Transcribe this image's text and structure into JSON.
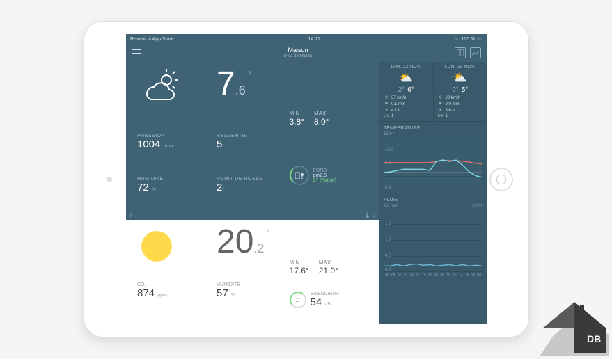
{
  "statusbar": {
    "left": "Revenir à App Store",
    "time": "14:17",
    "bt": "bluetooth",
    "battery": "100 %"
  },
  "header": {
    "title": "Maison",
    "subtitle": "il y a 3 minutes"
  },
  "outdoor": {
    "icon": "cloud-sun-icon",
    "temp_whole": "7",
    "temp_dec": ".6",
    "min_label": "MIN",
    "min": "3.8°",
    "max_label": "MAX",
    "max": "8.0°",
    "pressure_label": "PRESSION",
    "pressure": "1004",
    "pressure_unit": "mbar",
    "feels_label": "RESSENTIE",
    "feels": "5",
    "feels_deg": "°",
    "humidity_label": "HUMIDITÉ",
    "humidity": "72",
    "humidity_unit": "%",
    "dew_label": "POINT DE ROSÉE",
    "dew": "2",
    "dew_deg": "°",
    "fond_label": "FOND",
    "fond_pm": "pm2.5",
    "fond_value": "27 (Faible)"
  },
  "indoor": {
    "temp_whole": "20",
    "temp_dec": ".2",
    "min_label": "MIN",
    "min": "17.6°",
    "max_label": "MAX",
    "max": "21.0°",
    "co2_label": "CO₂",
    "co2": "874",
    "co2_unit": "ppm",
    "hum_label": "HUMIDITÉ",
    "hum": "57",
    "hum_unit": "%",
    "sound_label": "SILENCIEUX",
    "sound": "54",
    "sound_unit": "dB"
  },
  "forecast": [
    {
      "day": "DIM. 22 NOV.",
      "lo": "2°",
      "hi": "6°",
      "wind": "57 km/h",
      "rain": "0.1 mm",
      "sun": "4.1 h",
      "uv": "1"
    },
    {
      "day": "LUN. 23 NOV.",
      "lo": "0°",
      "hi": "5°",
      "wind": "20 km/h",
      "rain": "0.0 mm",
      "sun": "3.6 h",
      "uv": "1"
    }
  ],
  "temp_chart": {
    "title": "TEMPERATURE",
    "ylabels": [
      "15.0",
      "10.0",
      "5.0",
      "0.0"
    ],
    "top": "15.0 °"
  },
  "rain_chart": {
    "title": "PLUIE",
    "left": "2.0 mm",
    "right": "100%",
    "ylabels": [
      "1.5",
      "1.0",
      "0.5",
      "0.0"
    ],
    "xlabels": [
      "06",
      "08",
      "10",
      "12",
      "14",
      "16",
      "18",
      "00",
      "06",
      "08",
      "10",
      "12",
      "14",
      "16",
      "18",
      "00"
    ]
  },
  "chart_data": [
    {
      "type": "line",
      "title": "Temperature",
      "ylim": [
        0,
        15
      ],
      "x": [
        0,
        1,
        2,
        3,
        4,
        5,
        6,
        7,
        8,
        9,
        10,
        11,
        12,
        13,
        14,
        15
      ],
      "series": [
        {
          "name": "red",
          "values": [
            7,
            7,
            7,
            7,
            7,
            7,
            7,
            7,
            7.3,
            7.5,
            7.6,
            7.6,
            7.5,
            7.3,
            7,
            6.8
          ]
        },
        {
          "name": "cyan",
          "values": [
            4,
            4,
            4.5,
            5,
            5,
            5,
            5,
            4.5,
            7,
            7.5,
            7,
            7.6,
            6,
            4,
            3,
            2.5
          ]
        }
      ]
    },
    {
      "type": "line",
      "title": "Pluie",
      "ylim": [
        0,
        2
      ],
      "x": [
        0,
        1,
        2,
        3,
        4,
        5,
        6,
        7,
        8,
        9,
        10,
        11,
        12,
        13,
        14,
        15
      ],
      "series": [
        {
          "name": "rain",
          "values": [
            0.05,
            0.05,
            0.1,
            0.05,
            0.1,
            0.12,
            0.08,
            0.1,
            0.05,
            0.08,
            0.1,
            0.06,
            0.1,
            0.05,
            0.08,
            0.06
          ]
        }
      ]
    }
  ],
  "uv_label": "UV"
}
